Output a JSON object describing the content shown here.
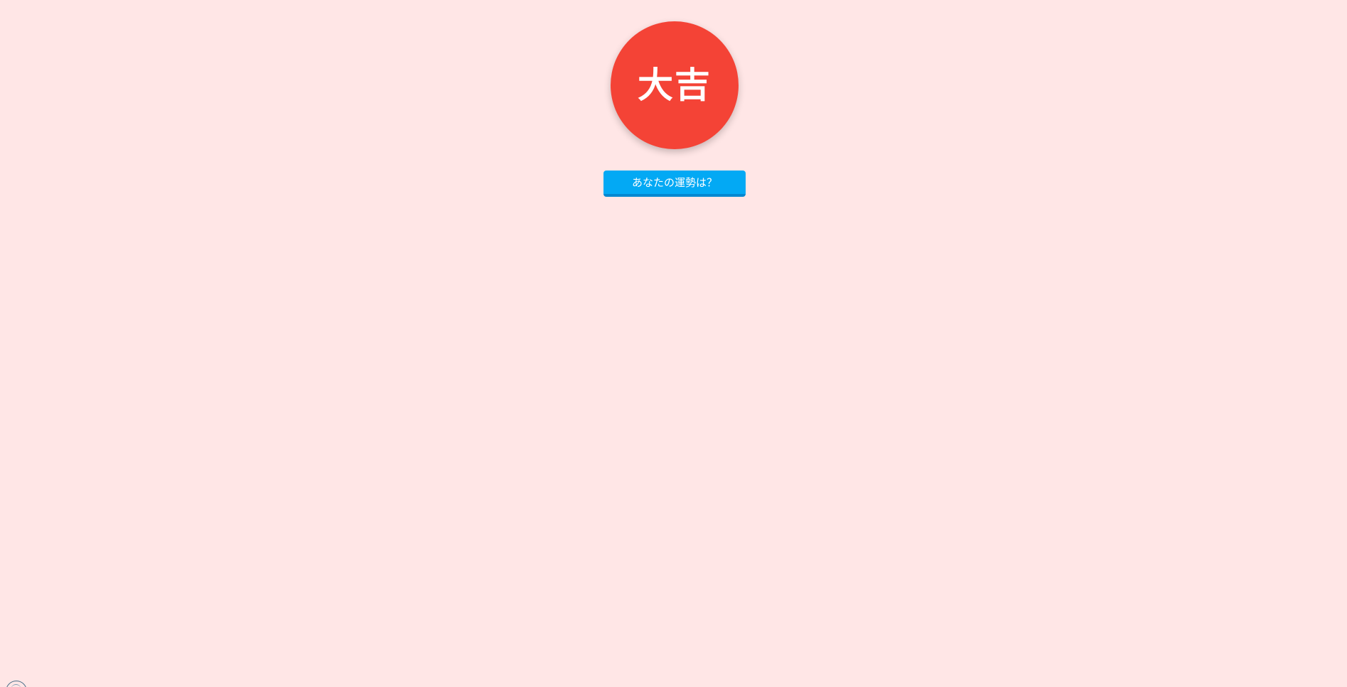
{
  "result": {
    "text": "大吉",
    "color": "#f44336"
  },
  "button": {
    "label": "あなたの運勢は？",
    "color": "#03a9f4"
  },
  "page": {
    "background": "#ffe6e6"
  },
  "corner_icon": {
    "name": "circle-badge-icon"
  }
}
